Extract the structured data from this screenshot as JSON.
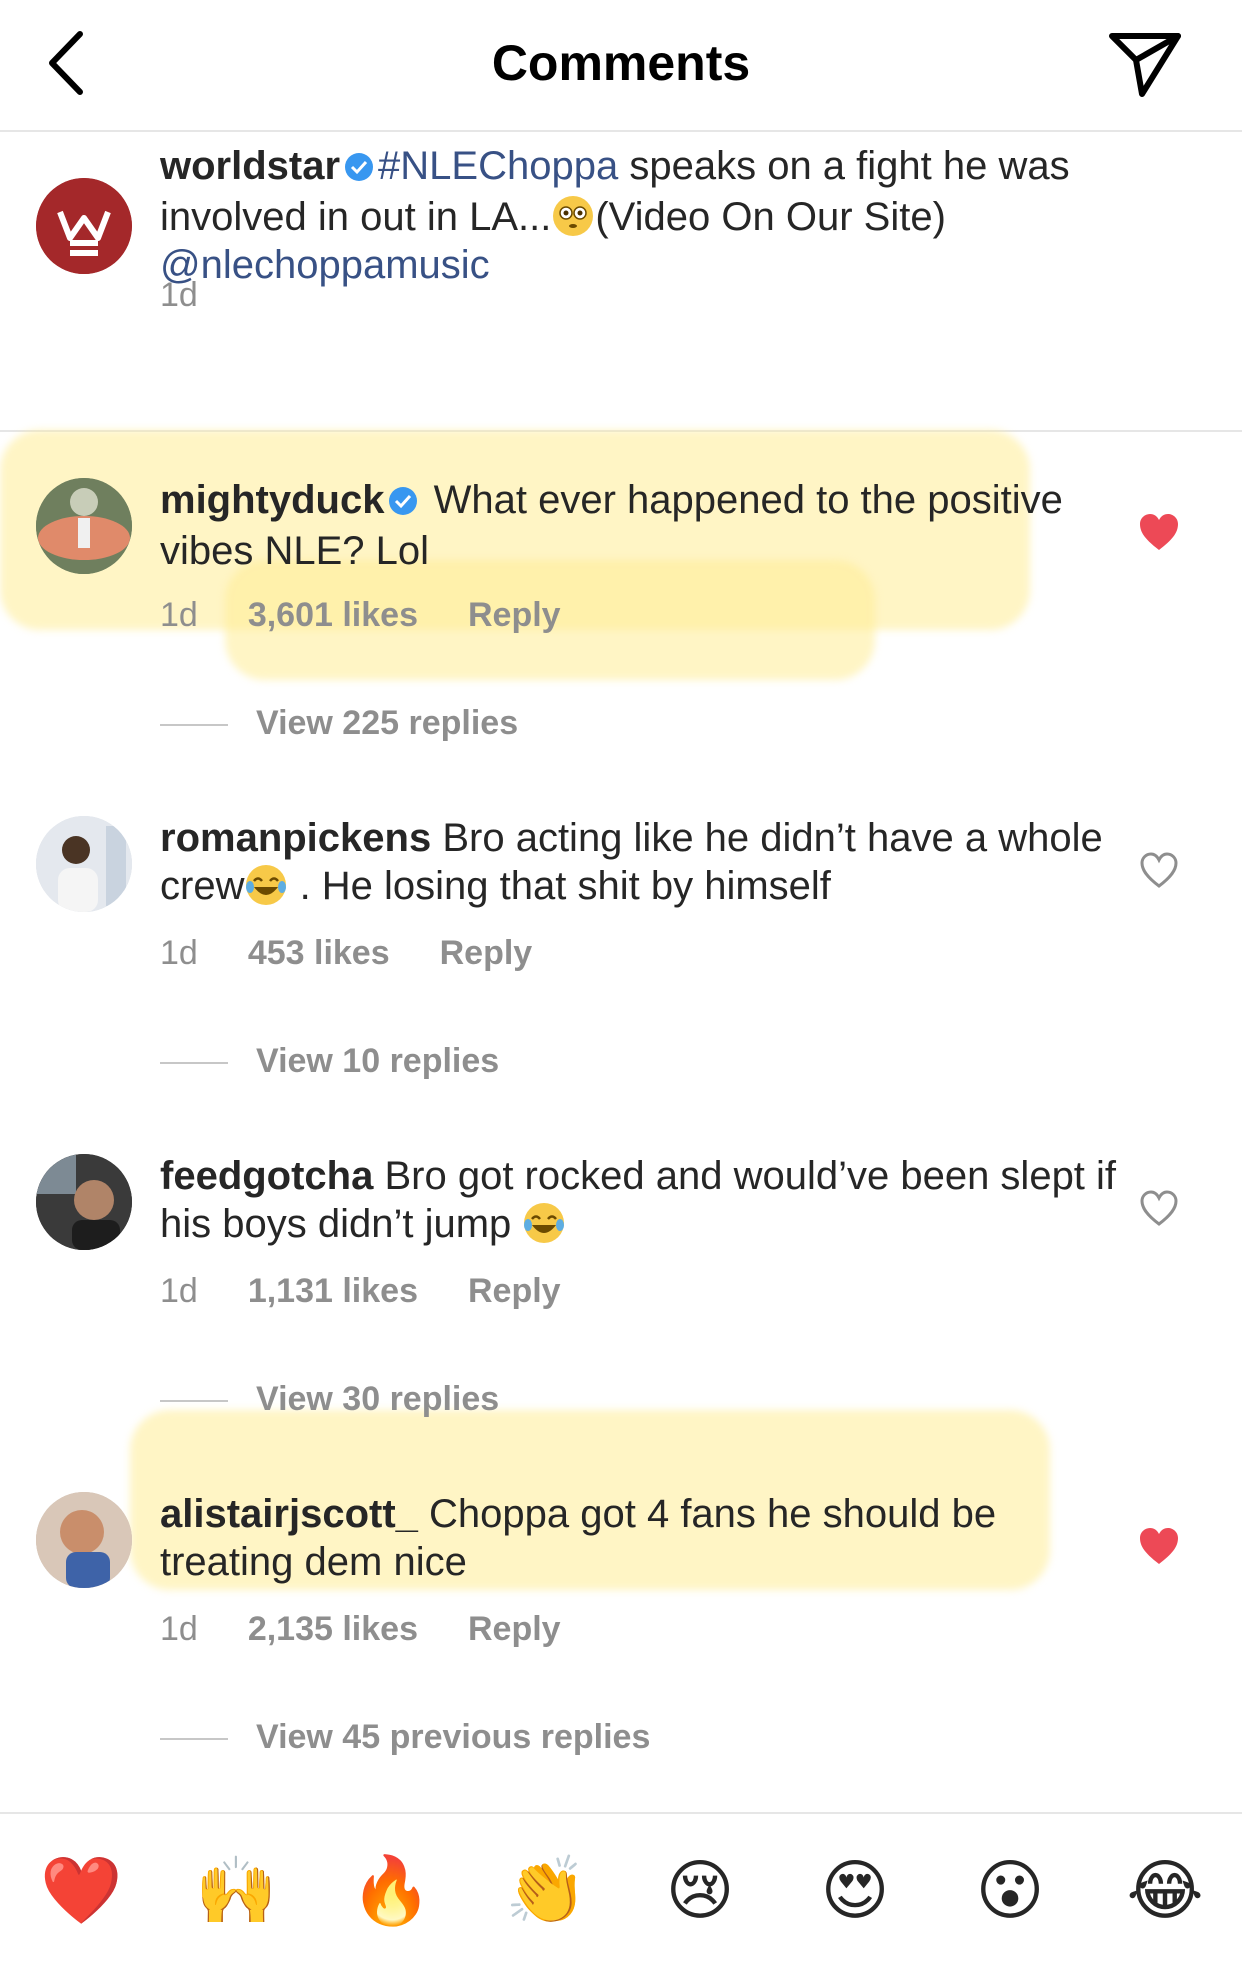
{
  "header": {
    "title": "Comments"
  },
  "caption": {
    "username": "worldstar",
    "hashtag": "#NLEChoppa",
    "text_1": " speaks on a fight he was involved in out in LA...",
    "text_2": "(Video On Our Site)",
    "mention": "@nlechoppamusic",
    "time": "1d"
  },
  "comments": [
    {
      "username": "mightyduck",
      "text": " What ever happened to the positive vibes NLE? Lol",
      "time": "1d",
      "likes": "3,601 likes",
      "reply": "Reply",
      "view_replies": "View 225 replies",
      "liked": true
    },
    {
      "username": "romanpickens",
      "text_1": " Bro acting like he didn’t have a whole crew",
      "text_2": " . He losing that shit by himself",
      "time": "1d",
      "likes": "453 likes",
      "reply": "Reply",
      "view_replies": "View 10 replies",
      "liked": false
    },
    {
      "username": "feedgotcha",
      "text": " Bro got rocked and would’ve been slept if his boys didn’t jump ",
      "time": "1d",
      "likes": "1,131 likes",
      "reply": "Reply",
      "view_replies": "View 30 replies",
      "liked": false
    },
    {
      "username": "alistairjscott_",
      "text": " Choppa got 4 fans he should be treating dem nice",
      "time": "1d",
      "likes": "2,135 likes",
      "reply": "Reply",
      "view_replies": "View 45 previous replies",
      "liked": true
    }
  ],
  "emoji_bar": [
    "❤️",
    "🙌",
    "🔥",
    "👏",
    "😢",
    "😍",
    "😮",
    "😂"
  ],
  "colors": {
    "like_red": "#ed4956",
    "link_blue": "#385185",
    "verified_blue": "#3897f0",
    "highlight": "#ffec96"
  }
}
